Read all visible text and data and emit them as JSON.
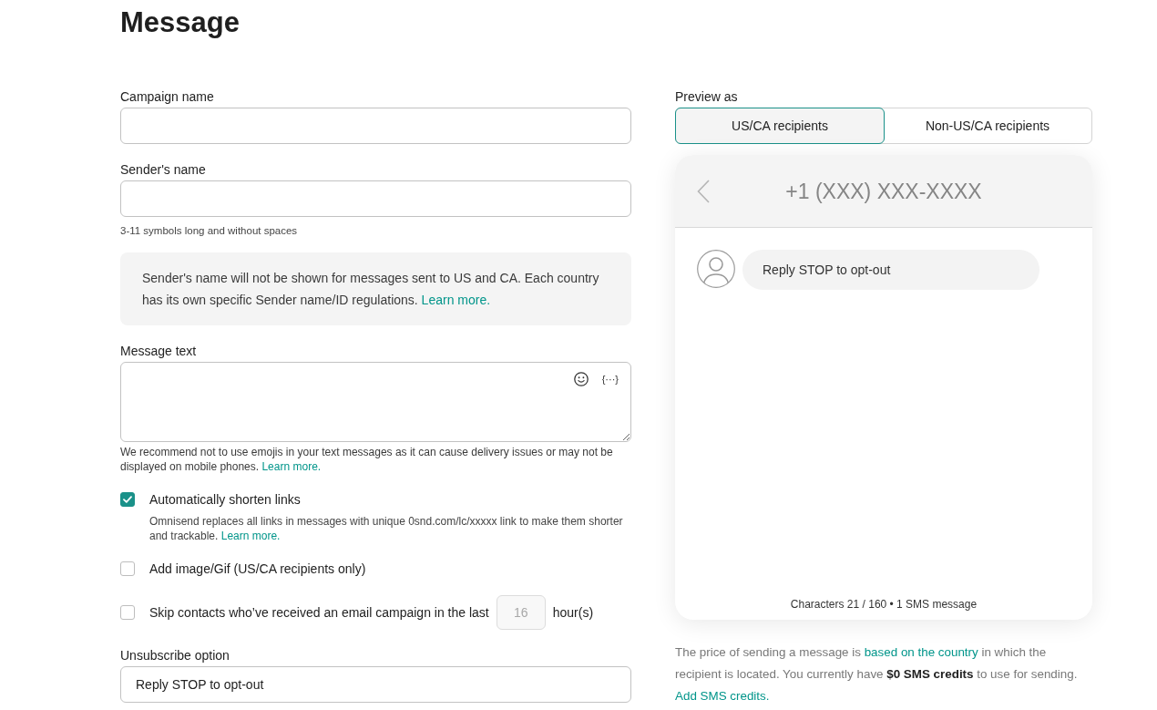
{
  "page": {
    "title": "Message"
  },
  "campaign_name": {
    "label": "Campaign name"
  },
  "sender_name": {
    "label": "Sender's name",
    "hint": "3-11 symbols long and without spaces"
  },
  "sender_notice": {
    "text": "Sender's name will not be shown for messages sent to US and CA. Each country has its own specific Sender name/ID regulations.",
    "link": "Learn more."
  },
  "message_text": {
    "label": "Message text",
    "variable_button": "{···}",
    "hint": "We recommend not to use emojis in your text messages as it can cause delivery issues or may not be displayed on mobile phones.",
    "link": "Learn more."
  },
  "options": [
    {
      "kind": "checkbox",
      "label": "Automatically shorten links",
      "checked": true,
      "description": "Omnisend replaces all links in messages with unique 0snd.com/lc/xxxxx link to make them shorter and trackable.",
      "link": "Learn more."
    },
    {
      "kind": "checkbox",
      "label": "Add image/Gif (US/CA recipients only)",
      "checked": false
    },
    {
      "kind": "hours",
      "label": "Skip contacts who’ve received an email campaign in the last",
      "checked": false,
      "value": "16",
      "disabled": true,
      "unit": "hour(s)"
    }
  ],
  "unsubscribe": {
    "label": "Unsubscribe option",
    "value": "Reply STOP to opt-out"
  },
  "preview": {
    "label": "Preview as",
    "tabs": [
      {
        "label": "US/CA recipients",
        "selected": true
      },
      {
        "label": "Non-US/CA recipients",
        "selected": false
      }
    ],
    "phone_number": "+1 (XXX) XXX-XXXX",
    "message": "Reply STOP to opt-out",
    "counter": "Characters 21 / 160 • 1 SMS message"
  },
  "price_note": [
    {
      "kind": "text",
      "text": "The price of sending a message is "
    },
    {
      "kind": "link",
      "text": "based on the country"
    },
    {
      "kind": "text",
      "text": " in which the recipient is located. You currently have **$0 SMS credits** to use for sending. "
    },
    {
      "kind": "link",
      "text": "Add SMS credits."
    }
  ]
}
